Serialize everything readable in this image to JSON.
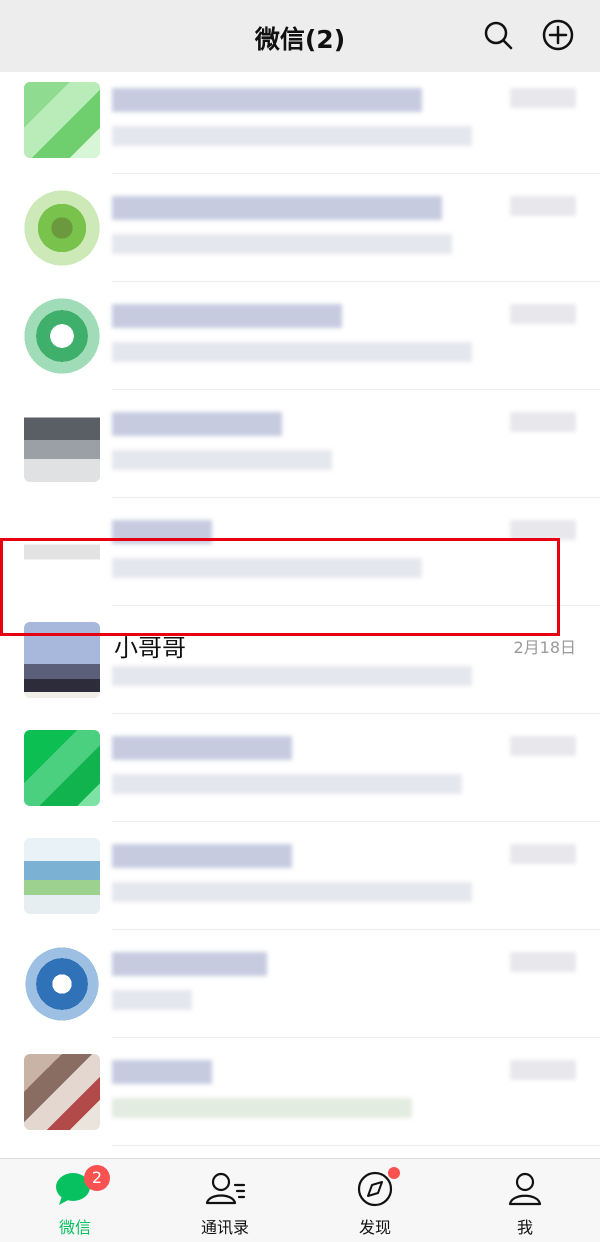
{
  "header": {
    "title": "微信(2)"
  },
  "chat_list": {
    "highlighted_item": {
      "name": "小哥哥",
      "time": "2月18日"
    }
  },
  "tabbar": {
    "tabs": [
      {
        "label": "微信",
        "badge": "2",
        "active": true
      },
      {
        "label": "通讯录"
      },
      {
        "label": "发现",
        "dot": true
      },
      {
        "label": "我"
      }
    ]
  },
  "colors": {
    "accent": "#07c160",
    "badge": "#fa5151",
    "highlight_border": "#e60012"
  }
}
